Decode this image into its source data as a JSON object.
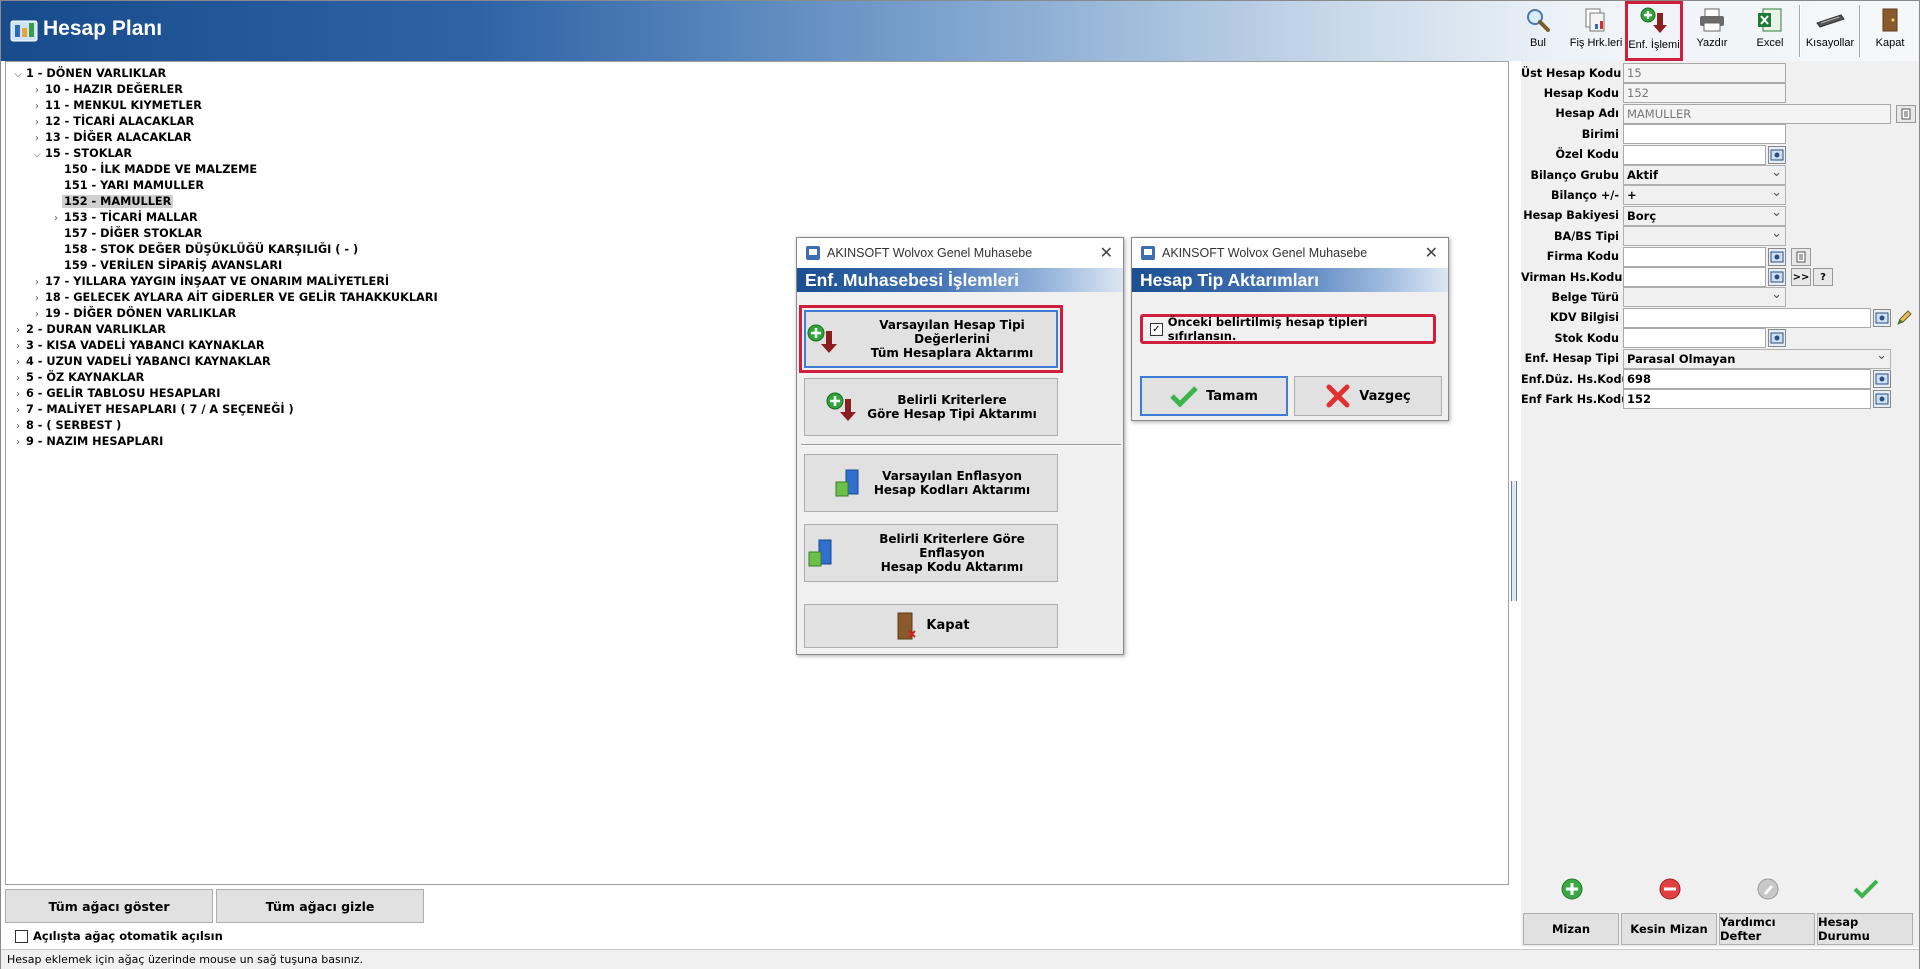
{
  "window": {
    "title": "Hesap Planı"
  },
  "toolbar": [
    {
      "id": "bul",
      "label": "Bul",
      "icon": "magnifier-icon"
    },
    {
      "id": "fis",
      "label": "Fiş Hrk.leri",
      "icon": "document-stack-icon"
    },
    {
      "id": "enf",
      "label": "Enf. İşlemi",
      "icon": "add-arrow-down-icon",
      "selected": true
    },
    {
      "id": "yazdir",
      "label": "Yazdır",
      "icon": "printer-icon"
    },
    {
      "id": "excel",
      "label": "Excel",
      "icon": "excel-icon"
    },
    {
      "id": "kisayollar",
      "label": "Kısayollar",
      "icon": "keyboard-icon"
    },
    {
      "id": "kapat",
      "label": "Kapat",
      "icon": "door-exit-icon"
    }
  ],
  "tree": [
    {
      "level": 0,
      "expanded": true,
      "label": "1 - DÖNEN VARLIKLAR"
    },
    {
      "level": 1,
      "expanded": false,
      "label": "10 - HAZIR DEĞERLER"
    },
    {
      "level": 1,
      "expanded": false,
      "label": "11 - MENKUL KIYMETLER"
    },
    {
      "level": 1,
      "expanded": false,
      "label": "12 - TİCARİ ALACAKLAR"
    },
    {
      "level": 1,
      "expanded": false,
      "label": "13 - DİĞER ALACAKLAR"
    },
    {
      "level": 1,
      "expanded": true,
      "label": "15 - STOKLAR"
    },
    {
      "level": 2,
      "leaf": true,
      "label": "150 - İLK MADDE VE MALZEME"
    },
    {
      "level": 2,
      "leaf": true,
      "label": "151 - YARI MAMULLER"
    },
    {
      "level": 2,
      "leaf": true,
      "label": "152 - MAMULLER",
      "selected": true
    },
    {
      "level": 2,
      "expanded": false,
      "label": "153 - TİCARİ MALLAR"
    },
    {
      "level": 2,
      "leaf": true,
      "label": "157 - DİĞER STOKLAR"
    },
    {
      "level": 2,
      "leaf": true,
      "label": "158 - STOK DEĞER DÜŞÜKLÜĞÜ KARŞILIĞI ( - )"
    },
    {
      "level": 2,
      "leaf": true,
      "label": "159 - VERİLEN SİPARİŞ AVANSLARI"
    },
    {
      "level": 1,
      "expanded": false,
      "label": "17 - YILLARA YAYGIN İNŞAAT VE ONARIM MALİYETLERİ"
    },
    {
      "level": 1,
      "expanded": false,
      "label": "18 - GELECEK AYLARA AİT GİDERLER VE GELİR TAHAKKUKLARI"
    },
    {
      "level": 1,
      "expanded": false,
      "label": "19 - DİĞER DÖNEN VARLIKLAR"
    },
    {
      "level": 0,
      "expanded": false,
      "label": "2 - DURAN VARLIKLAR"
    },
    {
      "level": 0,
      "expanded": false,
      "label": "3 - KISA VADELİ YABANCI KAYNAKLAR"
    },
    {
      "level": 0,
      "expanded": false,
      "label": "4 - UZUN VADELİ YABANCI KAYNAKLAR"
    },
    {
      "level": 0,
      "expanded": false,
      "label": "5 - ÖZ KAYNAKLAR"
    },
    {
      "level": 0,
      "expanded": false,
      "label": "6 - GELİR TABLOSU HESAPLARI"
    },
    {
      "level": 0,
      "expanded": false,
      "label": "7 - MALİYET HESAPLARI ( 7 / A  SEÇENEĞİ )"
    },
    {
      "level": 0,
      "expanded": false,
      "label": "8 - ( SERBEST )"
    },
    {
      "level": 0,
      "expanded": false,
      "label": "9 - NAZIM HESAPLARI"
    }
  ],
  "bottom": {
    "show_all": "Tüm ağacı göster",
    "hide_all": "Tüm ağacı gizle",
    "auto_open": "Açılışta ağaç otomatik açılsın",
    "status": "Hesap eklemek için ağaç üzerinde mouse un sağ tuşuna basınız."
  },
  "fields": [
    {
      "label": "Üst Hesap Kodu",
      "value": "15",
      "type": "readonly",
      "width": 163
    },
    {
      "label": "Hesap Kodu",
      "value": "152",
      "type": "readonly",
      "width": 163
    },
    {
      "label": "Hesap Adı",
      "value": "MAMULLER",
      "type": "readonly",
      "width": 268,
      "extra": "doc"
    },
    {
      "label": "Birimi",
      "value": "",
      "type": "text",
      "width": 163
    },
    {
      "label": "Özel Kodu",
      "value": "",
      "type": "lookup",
      "width": 143
    },
    {
      "label": "Bilanço Grubu",
      "value": "Aktif",
      "type": "select",
      "width": 163
    },
    {
      "label": "Bilanço +/-",
      "value": "+",
      "type": "select",
      "width": 163
    },
    {
      "label": "Hesap Bakiyesi",
      "value": "Borç",
      "type": "select",
      "width": 163
    },
    {
      "label": "BA/BS Tipi",
      "value": "",
      "type": "select",
      "width": 163
    },
    {
      "label": "Firma Kodu",
      "value": "",
      "type": "lookup",
      "width": 143,
      "extra": "doc"
    },
    {
      "label": "Virman Hs.Kodu",
      "value": "",
      "type": "lookup",
      "width": 143,
      "extra": "virman"
    },
    {
      "label": "Belge Türü",
      "value": "",
      "type": "select",
      "width": 163
    },
    {
      "label": "KDV Bilgisi",
      "value": "",
      "type": "lookup",
      "width": 248,
      "extra": "pen"
    },
    {
      "label": "Stok Kodu",
      "value": "",
      "type": "lookup",
      "width": 143
    },
    {
      "label": "Enf. Hesap Tipi",
      "value": "Parasal Olmayan",
      "type": "select",
      "width": 268
    },
    {
      "label": "Enf.Düz. Hs.Kodu",
      "value": "698",
      "type": "lookup",
      "width": 248
    },
    {
      "label": "Enf Fark Hs.Kodu",
      "value": "152",
      "type": "lookup",
      "width": 248
    }
  ],
  "right_buttons": [
    "Mizan",
    "Kesin Mizan",
    "Yardımcı Defter",
    "Hesap Durumu"
  ],
  "dialog1": {
    "app_title": "AKINSOFT Wolvox Genel Muhasebe",
    "header": "Enf. Muhasebesi İşlemleri",
    "btn1_line1": "Varsayılan Hesap Tipi Değerlerini",
    "btn1_line2": "Tüm Hesaplara Aktarımı",
    "btn2_line1": "Belirli Kriterlere",
    "btn2_line2": "Göre Hesap Tipi Aktarımı",
    "btn3_line1": "Varsayılan Enflasyon",
    "btn3_line2": "Hesap Kodları Aktarımı",
    "btn4_line1": "Belirli Kriterlere Göre Enflasyon",
    "btn4_line2": "Hesap Kodu Aktarımı",
    "close": "Kapat"
  },
  "dialog2": {
    "app_title": "AKINSOFT Wolvox Genel Muhasebe",
    "header": "Hesap Tip Aktarımları",
    "checkbox": "Önceki belirtilmiş hesap tipleri sıfırlansın.",
    "checked": true,
    "ok": "Tamam",
    "cancel": "Vazgeç"
  },
  "colors": {
    "accent_red": "#d01f3c",
    "title_blue": "#174b8c",
    "focus_blue": "#3d7bd4"
  }
}
